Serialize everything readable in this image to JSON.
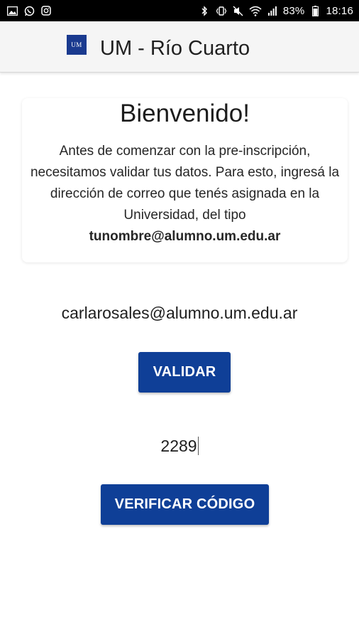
{
  "status_bar": {
    "left_icons": [
      "image-icon",
      "whatsapp-icon",
      "instagram-icon"
    ],
    "right_icons": [
      "bluetooth-icon",
      "vibrate-icon",
      "mute-icon",
      "wifi-icon",
      "signal-icon",
      "battery-icon"
    ],
    "battery": "83%",
    "time": "18:16"
  },
  "app_bar": {
    "logo_text": "UM",
    "title": "UM - Río Cuarto",
    "brand_color": "#1a3a8f"
  },
  "welcome": {
    "title": "Bienvenido!",
    "text": "Antes de comenzar con la pre-inscripción, necesitamos validar tus datos. Para esto, ingresá la dirección de correo que tenés asignada en la Universidad, del tipo",
    "email_example": "tunombre@alumno.um.edu.ar"
  },
  "form": {
    "email_value": "carlarosales@alumno.um.edu.ar",
    "validate_label": "VALIDAR",
    "code_value": "2289",
    "verify_label": "VERIFICAR CÓDIGO",
    "button_color": "#0f3f97"
  }
}
